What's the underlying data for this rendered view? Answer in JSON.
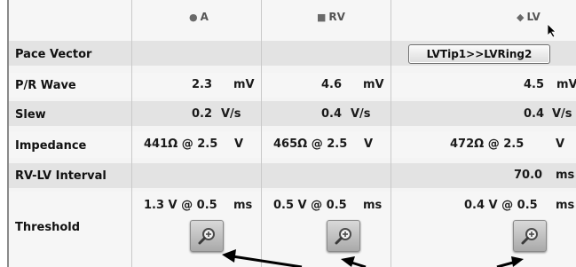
{
  "columns": {
    "a": {
      "icon": "circle-marker-icon",
      "label": "A"
    },
    "rv": {
      "icon": "square-marker-icon",
      "label": "RV"
    },
    "lv": {
      "icon": "diamond-marker-icon",
      "label": "LV"
    }
  },
  "rows": {
    "pace_vector": {
      "label": "Pace Vector",
      "lv_button": "LVTip1>>LVRing2"
    },
    "pr_wave": {
      "label": "P/R Wave",
      "a_value": "2.3",
      "a_unit": "mV",
      "rv_value": "4.6",
      "rv_unit": "mV",
      "lv_value": "4.5",
      "lv_unit": "mV"
    },
    "slew": {
      "label": "Slew",
      "a_value": "0.2",
      "a_unit": "V/s",
      "rv_value": "0.4",
      "rv_unit": "V/s",
      "lv_value": "0.4",
      "lv_unit": "V/s"
    },
    "impedance": {
      "label": "Impedance",
      "a_value": "441Ω @ 2.5",
      "a_unit": "V",
      "rv_value": "465Ω @ 2.5",
      "rv_unit": "V",
      "lv_value": "472Ω @ 2.5",
      "lv_unit": "V"
    },
    "rvlv_interval": {
      "label": "RV-LV Interval",
      "lv_value": "70.0",
      "lv_unit": "ms"
    },
    "threshold": {
      "label": "Threshold",
      "a_value": "1.3 V @ 0.5",
      "a_unit": "ms",
      "rv_value": "0.5 V @ 0.5",
      "rv_unit": "ms",
      "lv_value": "0.4 V @ 0.5",
      "lv_unit": "ms"
    }
  },
  "icons": {
    "zoom": "magnifier-zoom-icon",
    "cursor": "mouse-pointer-icon",
    "annotation": "annotation-arrow-icon"
  }
}
